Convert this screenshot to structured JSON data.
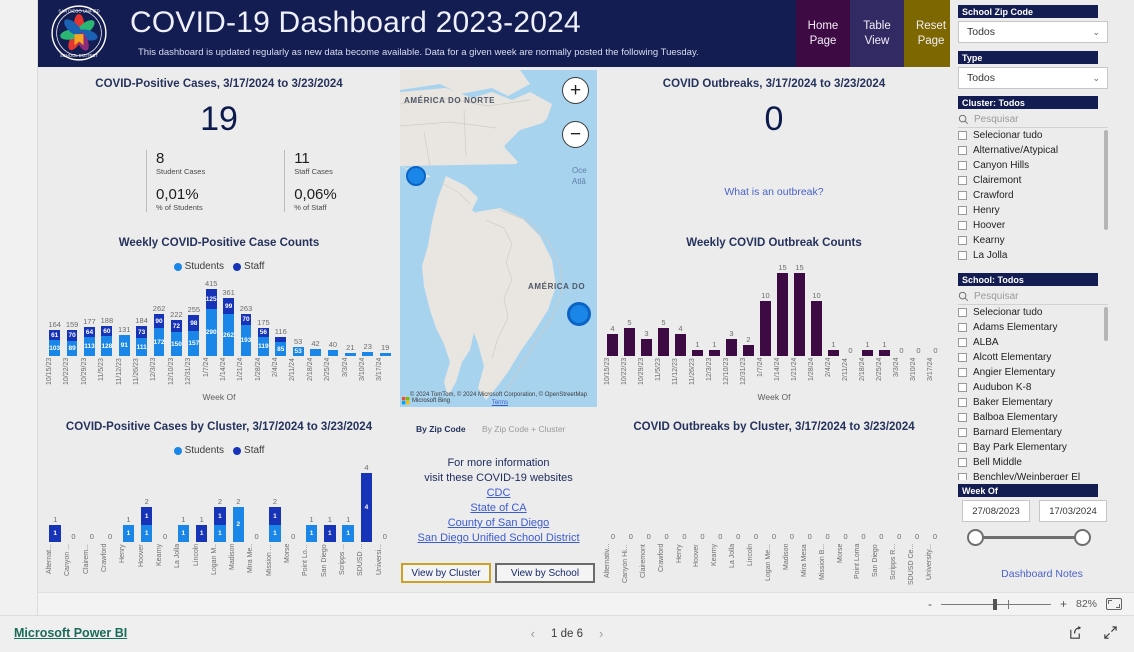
{
  "header": {
    "title": "COVID-19 Dashboard 2023-2024",
    "subtitle": "This dashboard is updated regularly as new data become available. Data for a given week are normally posted the following Tuesday.",
    "logo_alt": "San Diego Unified School District",
    "nav": [
      {
        "line1": "Home",
        "line2": "Page",
        "color": "#3d0a44"
      },
      {
        "line1": "Table",
        "line2": "View",
        "color": "#322a63"
      },
      {
        "line1": "Reset",
        "line2": "Page",
        "color": "#7d6700"
      }
    ]
  },
  "cases_kpi": {
    "title": "COVID-Positive Cases, 3/17/2024 to 3/23/2024",
    "total": "19",
    "student_cases": "8",
    "student_cases_label": "Student Cases",
    "student_pct": "0,01%",
    "student_pct_label": "% of Students",
    "staff_cases": "11",
    "staff_cases_label": "Staff Cases",
    "staff_pct": "0,06%",
    "staff_pct_label": "% of Staff"
  },
  "outbreak_kpi": {
    "title": "COVID Outbreaks, 3/17/2024 to 3/23/2024",
    "total": "0",
    "link": "What is an outbreak?"
  },
  "legend": {
    "students": "Students",
    "staff": "Staff",
    "students_color": "#1a87e8",
    "staff_color": "#1733b8"
  },
  "map": {
    "label_north": "AMÉRICA DO NORTE",
    "label_south": "AMÉRICA DO",
    "label_sea_1": "Oce",
    "label_sea_2": "Atlâ",
    "zoom_in": "+",
    "zoom_out": "−",
    "attribution": "© 2024 TomTom, © 2024 Microsoft Corporation, © OpenStreetMap",
    "attribution_terms": "Terms",
    "attribution_brand": "Microsoft Bing",
    "slicer_selected": "By Zip Code",
    "slicer_other": "By Zip Code + Cluster"
  },
  "info": {
    "line1": "For more information",
    "line2": "visit these COVID-19 websites",
    "links": [
      "CDC",
      "State of CA",
      "County of San Diego",
      "San Diego Unified School District"
    ],
    "view_by_cluster": "View by Cluster",
    "view_by_school": "View by School"
  },
  "filters": {
    "zip": {
      "title": "School Zip Code",
      "value": "Todos"
    },
    "type": {
      "title": "Type",
      "value": "Todos"
    },
    "cluster": {
      "title": "Cluster: Todos",
      "search_placeholder": "Pesquisar",
      "items": [
        "Selecionar tudo",
        "Alternative/Atypical",
        "Canyon Hills",
        "Clairemont",
        "Crawford",
        "Henry",
        "Hoover",
        "Kearny",
        "La Jolla"
      ]
    },
    "school": {
      "title": "School: Todos",
      "search_placeholder": "Pesquisar",
      "items": [
        "Selecionar tudo",
        "Adams Elementary",
        "ALBA",
        "Alcott Elementary",
        "Angier Elementary",
        "Audubon K-8",
        "Baker Elementary",
        "Balboa Elementary",
        "Barnard Elementary",
        "Bay Park Elementary",
        "Bell Middle",
        "Benchley/Weinberger El"
      ]
    },
    "week": {
      "title": "Week Of",
      "start": "27/08/2023",
      "end": "17/03/2024"
    },
    "notes_link": "Dashboard Notes"
  },
  "statusbar": {
    "zoom": "82%",
    "minus": "-",
    "plus": "+"
  },
  "footer": {
    "brand": "Microsoft Power BI",
    "page": "1 de 6",
    "prev": "‹",
    "next": "›"
  },
  "chart_data": [
    {
      "type": "bar",
      "name": "weekly-covid-positive-case-counts",
      "title": "Weekly COVID-Positive Case Counts",
      "xlabel": "Week Of",
      "ylabel": "",
      "stacked": true,
      "categories": [
        "10/15/23",
        "10/22/23",
        "10/29/23",
        "11/5/23",
        "11/12/23",
        "11/26/23",
        "12/3/23",
        "12/10/23",
        "12/31/23",
        "1/7/24",
        "1/14/24",
        "1/21/24",
        "1/28/24",
        "2/4/24",
        "2/11/24",
        "2/18/24",
        "2/25/24",
        "3/3/24",
        "3/10/24",
        "3/17/24"
      ],
      "series": [
        {
          "name": "Students",
          "color": "#1a87e8",
          "values": [
            103,
            89,
            113,
            128,
            91,
            111,
            172,
            150,
            157,
            290,
            262,
            193,
            119,
            85,
            53,
            42,
            40,
            21,
            23,
            19
          ]
        },
        {
          "name": "Staff",
          "color": "#1733b8",
          "values": [
            61,
            70,
            64,
            60,
            0,
            73,
            90,
            72,
            98,
            125,
            99,
            70,
            56,
            31,
            0,
            0,
            0,
            0,
            0,
            0
          ]
        }
      ],
      "totals": [
        164,
        159,
        177,
        188,
        131,
        184,
        262,
        222,
        255,
        415,
        361,
        263,
        175,
        116,
        53,
        42,
        40,
        21,
        23,
        19
      ],
      "ylim": [
        0,
        415
      ]
    },
    {
      "type": "bar",
      "name": "weekly-covid-outbreak-counts",
      "title": "Weekly COVID Outbreak Counts",
      "xlabel": "Week Of",
      "ylabel": "",
      "color": "#3d0a44",
      "categories": [
        "10/15/23",
        "10/22/23",
        "10/29/23",
        "11/5/23",
        "11/12/23",
        "11/26/23",
        "12/3/23",
        "12/10/23",
        "12/31/23",
        "1/7/24",
        "1/14/24",
        "1/21/24",
        "1/28/24",
        "2/4/24",
        "2/11/24",
        "2/18/24",
        "2/25/24",
        "3/3/24",
        "3/10/24",
        "3/17/24"
      ],
      "values": [
        4,
        5,
        3,
        5,
        4,
        1,
        1,
        3,
        2,
        10,
        15,
        15,
        10,
        1,
        0,
        1,
        1,
        0,
        0,
        0
      ],
      "ylim": [
        0,
        15
      ]
    },
    {
      "type": "bar",
      "name": "covid-positive-cases-by-cluster",
      "title": "COVID-Positive Cases by Cluster, 3/17/2024 to 3/23/2024",
      "xlabel": "",
      "stacked": true,
      "categories": [
        "Alternat...",
        "Canyon ...",
        "Clairem...",
        "Crawford",
        "Henry",
        "Hoover",
        "Kearny",
        "La Jolla",
        "Lincoln",
        "Logan M..",
        "Madison",
        "Mira Me..",
        "Mission ...",
        "Morse",
        "Point Lo...",
        "San Diego",
        "Scripps ...",
        "SDUSD ...",
        "Universi..."
      ],
      "series": [
        {
          "name": "Students",
          "color": "#1a87e8",
          "values": [
            0,
            0,
            0,
            0,
            1,
            1,
            0,
            1,
            0,
            1,
            2,
            0,
            1,
            0,
            1,
            0,
            1,
            0,
            0
          ]
        },
        {
          "name": "Staff",
          "color": "#1733b8",
          "values": [
            1,
            0,
            0,
            0,
            0,
            1,
            0,
            0,
            1,
            1,
            0,
            0,
            1,
            0,
            0,
            1,
            0,
            4,
            0
          ]
        }
      ],
      "totals": [
        1,
        0,
        0,
        0,
        1,
        2,
        0,
        1,
        1,
        2,
        2,
        0,
        2,
        0,
        1,
        1,
        1,
        4,
        0
      ],
      "ylim": [
        0,
        4
      ]
    },
    {
      "type": "bar",
      "name": "covid-outbreaks-by-cluster",
      "title": "COVID Outbreaks by Cluster, 3/17/2024 to 3/23/2024",
      "xlabel": "",
      "color": "#3d0a44",
      "categories": [
        "Alternativ...",
        "Canyon Hi...",
        "Clairemont",
        "Crawford",
        "Henry",
        "Hoover",
        "Kearny",
        "La Jolla",
        "Lincoln",
        "Logan Me...",
        "Madison",
        "Mira Mesa",
        "Mission B...",
        "Morse",
        "Point Loma",
        "San Diego",
        "Scripps R...",
        "SDUSD Ce...",
        "University..."
      ],
      "values": [
        0,
        0,
        0,
        0,
        0,
        0,
        0,
        0,
        0,
        0,
        0,
        0,
        0,
        0,
        0,
        0,
        0,
        0,
        0
      ],
      "ylim": [
        0,
        1
      ]
    }
  ]
}
